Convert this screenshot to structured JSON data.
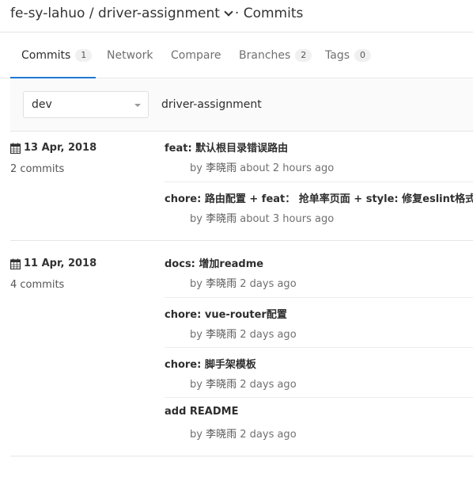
{
  "header": {
    "namespace": "fe-sy-lahuo",
    "separator": " / ",
    "project": "driver-assignment",
    "suffix": "· Commits"
  },
  "tabs": [
    {
      "label": "Commits",
      "count": "1",
      "active": true
    },
    {
      "label": "Network"
    },
    {
      "label": "Compare"
    },
    {
      "label": "Branches",
      "count": "2"
    },
    {
      "label": "Tags",
      "count": "0"
    }
  ],
  "filter": {
    "branch": "dev",
    "repo_name": "driver-assignment"
  },
  "days": [
    {
      "date": "13 Apr, 2018",
      "count_label": "2 commits",
      "commits": [
        {
          "title": "feat: 默认根目录错误路由",
          "by": "by",
          "author": "李晓雨",
          "time": "about 2 hours ago"
        },
        {
          "title": "chore: 路由配置 + feat： 抢单率页面 + style: 修复eslint格式",
          "by": "by",
          "author": "李晓雨",
          "time": "about 3 hours ago"
        }
      ]
    },
    {
      "date": "11 Apr, 2018",
      "count_label": "4 commits",
      "commits": [
        {
          "title": "docs: 增加readme",
          "by": "by",
          "author": "李晓雨",
          "time": "2 days ago"
        },
        {
          "title": "chore: vue-router配置",
          "by": "by",
          "author": "李晓雨",
          "time": "2 days ago"
        },
        {
          "title": "chore: 脚手架模板",
          "by": "by",
          "author": "李晓雨",
          "time": "2 days ago"
        },
        {
          "title": "add README",
          "by": "by",
          "author": "李晓雨",
          "time": "2 days ago"
        }
      ]
    }
  ],
  "icons": {
    "calendar": "calendar-icon",
    "dropdown": "chevron-down-icon"
  },
  "colors": {
    "active_tab_underline": "#1f78d1",
    "text": "#2e2e2e",
    "muted": "#707070"
  }
}
